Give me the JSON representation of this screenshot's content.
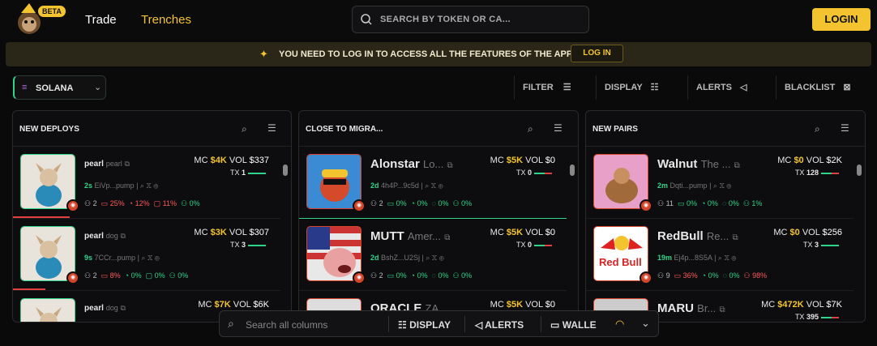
{
  "header": {
    "beta": "BETA",
    "nav": [
      "Trade",
      "Trenches"
    ],
    "search_placeholder": "SEARCH BY TOKEN OR CA...",
    "login": "LOGIN"
  },
  "banner": {
    "message": "YOU NEED TO LOG IN TO ACCESS ALL THE FEATURES OF THE APP",
    "button": "LOG IN"
  },
  "toolbar": {
    "chain": "SOLANA",
    "filter": "FILTER",
    "display": "DISPLAY",
    "alerts": "ALERTS",
    "blacklist": "BLACKLIST"
  },
  "columns": [
    {
      "title": "NEW DEPLOYS",
      "cards": [
        {
          "name": "pearl",
          "sub": "pearl",
          "mc": "$4K",
          "vol": "$337",
          "tx": "1",
          "age": "2s",
          "addr": "EiVp...pump",
          "holders": "2",
          "s1": "25%",
          "s2": "12%",
          "s3": "11%",
          "s4": "0%"
        },
        {
          "name": "pearl",
          "sub": "dog",
          "mc": "$3K",
          "vol": "$307",
          "tx": "3",
          "age": "9s",
          "addr": "7CCr...pump",
          "holders": "2",
          "s1": "8%",
          "s2": "0%",
          "s3": "0%",
          "s4": "0%"
        },
        {
          "name": "pearl",
          "sub": "dog",
          "mc": "$7K",
          "vol": "$6K"
        }
      ]
    },
    {
      "title": "CLOSE TO MIGRA...",
      "cards": [
        {
          "name": "Alonstar",
          "sub": "Lo...",
          "mc": "$5K",
          "vol": "$0",
          "tx": "0",
          "age": "2d",
          "addr": "4h4P...9c5d",
          "holders": "2",
          "s1": "0%",
          "s2": "0%",
          "s3": "0%",
          "s4": "0%"
        },
        {
          "name": "MUTT",
          "sub": "Amer...",
          "mc": "$5K",
          "vol": "$0",
          "tx": "0",
          "age": "2d",
          "addr": "BshZ...U2Sj",
          "holders": "2",
          "s1": "0%",
          "s2": "0%",
          "s3": "0%",
          "s4": "0%"
        },
        {
          "name": "ORACLE",
          "sub": "ZA...",
          "mc": "$5K",
          "vol": "$0"
        }
      ]
    },
    {
      "title": "NEW PAIRS",
      "cards": [
        {
          "name": "Walnut",
          "sub": "The ...",
          "mc": "$0",
          "vol": "$2K",
          "tx": "128",
          "age": "2m",
          "addr": "Dqti...pump",
          "holders": "11",
          "s1": "0%",
          "s2": "0%",
          "s3": "0%",
          "s4": "1%"
        },
        {
          "name": "RedBull",
          "sub": "Re...",
          "mc": "$0",
          "vol": "$256",
          "tx": "3",
          "age": "19m",
          "addr": "Ej4p...8S5A",
          "holders": "9",
          "s1": "36%",
          "s2": "0%",
          "s3": "0%",
          "s4": "98%"
        },
        {
          "name": "MARU",
          "sub": "Br...",
          "mc": "$472K",
          "vol": "$7K",
          "tx": "395"
        }
      ]
    }
  ],
  "bottom": {
    "search_placeholder": "Search all columns",
    "display": "DISPLAY",
    "alerts": "ALERTS",
    "wallet": "WALLE"
  },
  "labels": {
    "mc": "MC",
    "vol": "VOL",
    "tx": "TX",
    "redbull": "Red Bull"
  }
}
